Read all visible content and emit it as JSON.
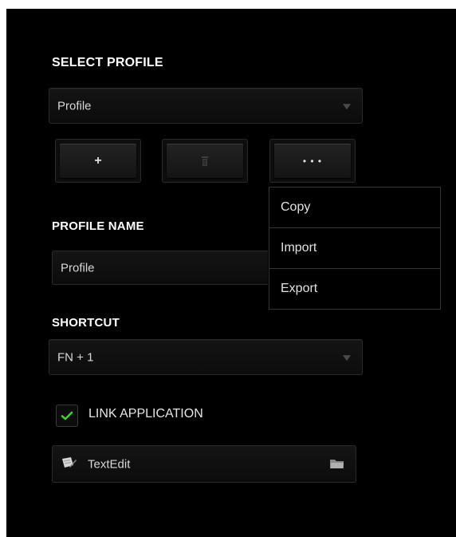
{
  "select_profile": {
    "heading": "SELECT PROFILE",
    "dropdown_value": "Profile"
  },
  "profile_buttons": {
    "add_label": "+",
    "more_label": "• • •"
  },
  "profile_menu": {
    "items": [
      {
        "label": "Copy"
      },
      {
        "label": "Import"
      },
      {
        "label": "Export"
      }
    ]
  },
  "profile_name": {
    "heading": "PROFILE NAME",
    "value": "Profile"
  },
  "shortcut": {
    "heading": "SHORTCUT",
    "value": "FN + 1"
  },
  "link_application": {
    "label": "LINK APPLICATION",
    "checked": true,
    "app_name": "TextEdit"
  },
  "colors": {
    "background": "#000000",
    "check_green": "#3ecf2a"
  },
  "icons": [
    "chevron-down-icon",
    "plus-icon",
    "trash-icon",
    "more-icon",
    "checkmark-icon",
    "app-icon",
    "folder-icon"
  ]
}
